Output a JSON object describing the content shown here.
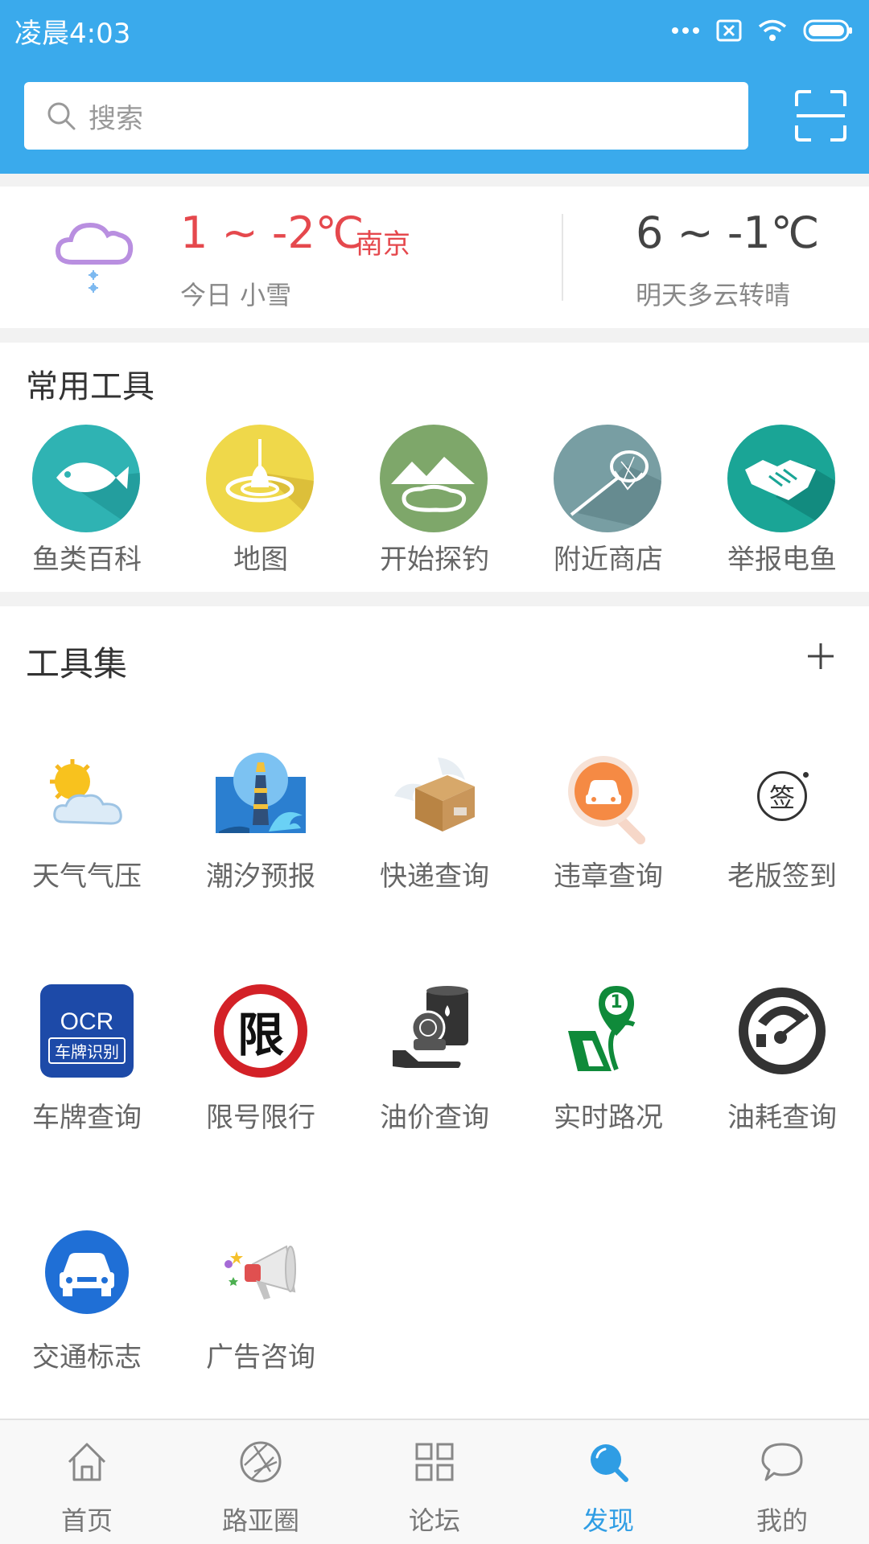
{
  "status_bar": {
    "time": "凌晨4:03"
  },
  "search": {
    "placeholder": "搜索"
  },
  "weather": {
    "today_range": "1 ~ -2℃",
    "city": "南京",
    "today_desc": "今日 小雪",
    "tomorrow_range": "6 ~ -1℃",
    "tomorrow_desc": "明天多云转晴"
  },
  "common_tools": {
    "title": "常用工具",
    "items": [
      {
        "label": "鱼类百科",
        "icon": "fish-icon",
        "color": "#2fb3b3"
      },
      {
        "label": "地图",
        "icon": "float-icon",
        "color": "#efd84a"
      },
      {
        "label": "开始探钓",
        "icon": "mountain-lake-icon",
        "color": "#7ea76a"
      },
      {
        "label": "附近商店",
        "icon": "fishing-net-icon",
        "color": "#789ea3"
      },
      {
        "label": "举报电鱼",
        "icon": "handshake-icon",
        "color": "#1aa596"
      }
    ]
  },
  "toolset": {
    "title": "工具集",
    "items": [
      {
        "label": "天气气压",
        "icon": "sun-cloud-icon"
      },
      {
        "label": "潮汐预报",
        "icon": "lighthouse-icon"
      },
      {
        "label": "快递查询",
        "icon": "winged-package-icon"
      },
      {
        "label": "违章查询",
        "icon": "car-search-icon"
      },
      {
        "label": "老版签到",
        "icon": "signin-stamp-icon",
        "glyph": "签"
      },
      {
        "label": "车牌查询",
        "icon": "ocr-plate-icon",
        "line1": "OCR",
        "line2": "车牌识别"
      },
      {
        "label": "限号限行",
        "icon": "restriction-sign-icon",
        "glyph": "限"
      },
      {
        "label": "油价查询",
        "icon": "oil-barrel-icon"
      },
      {
        "label": "实时路况",
        "icon": "road-pin-icon",
        "glyph": "1"
      },
      {
        "label": "油耗查询",
        "icon": "fuel-gauge-icon"
      },
      {
        "label": "交通标志",
        "icon": "traffic-sign-car-icon"
      },
      {
        "label": "广告咨询",
        "icon": "megaphone-icon"
      }
    ]
  },
  "bottom_nav": {
    "items": [
      {
        "label": "首页",
        "icon": "home-icon"
      },
      {
        "label": "路亚圈",
        "icon": "aperture-icon"
      },
      {
        "label": "论坛",
        "icon": "grid-icon"
      },
      {
        "label": "发现",
        "icon": "discover-search-icon",
        "active": true
      },
      {
        "label": "我的",
        "icon": "chat-bubble-icon"
      }
    ],
    "active_color": "#2f9de4"
  }
}
